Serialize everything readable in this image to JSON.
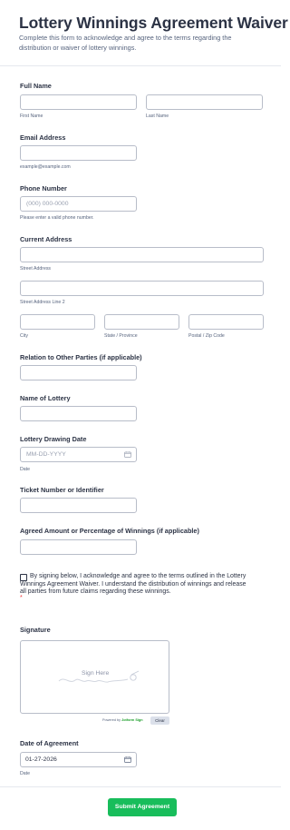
{
  "form": {
    "title": "Lottery Winnings Agreement Waiver",
    "subtitle": "Complete this form to acknowledge and agree to the terms regarding the distribution or waiver of lottery winnings."
  },
  "full_name": {
    "label": "Full Name",
    "first_sublabel": "First Name",
    "last_sublabel": "Last Name"
  },
  "email": {
    "label": "Email Address",
    "sublabel": "example@example.com"
  },
  "phone": {
    "label": "Phone Number",
    "placeholder": "(000) 000-0000",
    "sublabel": "Please enter a valid phone number."
  },
  "address": {
    "label": "Current Address",
    "street_sublabel": "Street Address",
    "street2_sublabel": "Street Address Line 2",
    "city_sublabel": "City",
    "state_sublabel": "State / Province",
    "zip_sublabel": "Postal / Zip Code"
  },
  "relation": {
    "label": "Relation to Other Parties (if applicable)"
  },
  "lottery_name": {
    "label": "Name of Lottery"
  },
  "drawing_date": {
    "label": "Lottery Drawing Date",
    "placeholder": "MM-DD-YYYY",
    "sublabel": "Date",
    "icon": "calendar-icon"
  },
  "ticket": {
    "label": "Ticket Number or Identifier"
  },
  "amount": {
    "label": "Agreed Amount or Percentage of Winnings (if applicable)"
  },
  "consent": {
    "text": "By signing below, I acknowledge and agree to the terms outlined in the Lottery Winnings Agreement Waiver. I understand the distribution of winnings and release all parties from future claims regarding these winnings.",
    "required_mark": "*",
    "checked": false
  },
  "signature": {
    "label": "Signature",
    "pad_text": "Sign Here",
    "powered_prefix": "Powered by",
    "powered_brand": "Jotform Sign",
    "clear_label": "Clear"
  },
  "agreement_date": {
    "label": "Date of Agreement",
    "value": "01-27-2026",
    "sublabel": "Date",
    "icon": "calendar-icon"
  },
  "submit": {
    "label": "Submit Agreement"
  },
  "colors": {
    "accent": "#18bd5b",
    "text": "#2c3345",
    "muted": "#57647e",
    "border": "#b8bdc9",
    "required": "#f23a3c"
  }
}
